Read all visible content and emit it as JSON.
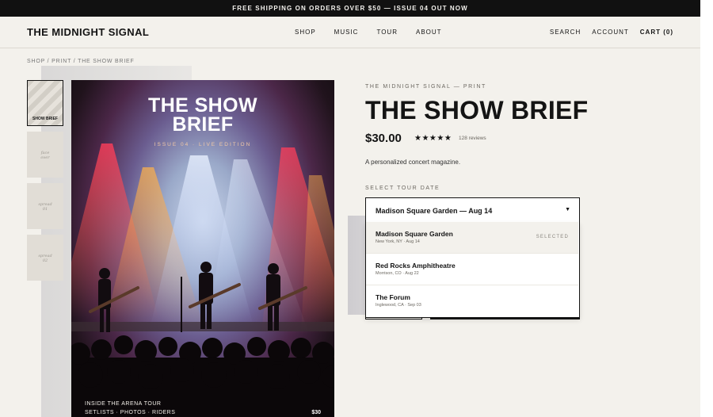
{
  "announcement": "FREE SHIPPING ON ORDERS OVER $50 — ISSUE 04 OUT NOW",
  "brand": "THE MIDNIGHT SIGNAL",
  "nav": [
    "SHOP",
    "MUSIC",
    "TOUR",
    "ABOUT"
  ],
  "utility": {
    "search": "SEARCH",
    "account": "ACCOUNT",
    "cart": "CART (0)"
  },
  "breadcrumb": "SHOP / PRINT / THE SHOW BRIEF",
  "thumbnails": [
    {
      "label": "SHOW BRIEF",
      "note": ""
    },
    {
      "label": "",
      "note": "face\nover"
    },
    {
      "label": "",
      "note": "spread\n01"
    },
    {
      "label": "",
      "note": "spread\n02"
    }
  ],
  "cover": {
    "title_line1": "THE SHOW",
    "title_line2": "BRIEF",
    "issue": "ISSUE 04 · LIVE EDITION",
    "footer_line1": "INSIDE THE ARENA TOUR",
    "footer_line2": "SETLISTS · PHOTOS · RIDERS",
    "price": "$30"
  },
  "product": {
    "eyebrow": "THE MIDNIGHT SIGNAL — PRINT",
    "title": "THE SHOW BRIEF",
    "price": "$30.00",
    "rating_stars": "★★★★★",
    "reviews": "128 reviews",
    "description": "A personalized concert magazine."
  },
  "tour_select": {
    "label": "SELECT TOUR DATE",
    "value": "Madison Square Garden — Aug 14",
    "options": [
      {
        "name": "Madison Square Garden",
        "meta": "New York, NY · Aug 14",
        "tag": "SELECTED"
      },
      {
        "name": "Red Rocks Amphitheatre",
        "meta": "Morrison, CO · Aug 22",
        "tag": ""
      },
      {
        "name": "The Forum",
        "meta": "Inglewood, CA · Sep 03",
        "tag": ""
      }
    ]
  },
  "colors": {
    "page_bg": "#f3f1ec",
    "ink": "#141414",
    "announce_bg": "#111111"
  }
}
